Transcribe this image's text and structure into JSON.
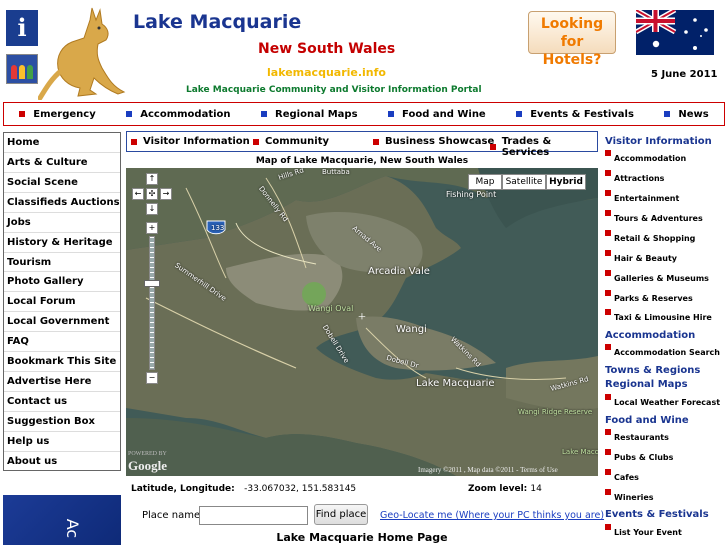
{
  "header": {
    "site_title": "Lake Macquarie",
    "state": "New South Wales",
    "domain": "lakemacquarie.info",
    "portal": "Lake Macquarie Community and Visitor Information Portal",
    "hotels_line1": "Looking for",
    "hotels_line2": "Hotels?",
    "date": "5 June 2011",
    "info_glyph": "i"
  },
  "top_nav": [
    {
      "label": "Emergency",
      "color": "#cc0000"
    },
    {
      "label": "Accommodation",
      "color": "#1a3dc0"
    },
    {
      "label": "Regional Maps",
      "color": "#1a3dc0"
    },
    {
      "label": "Food and Wine",
      "color": "#1a3dc0"
    },
    {
      "label": "Events & Festivals",
      "color": "#1a3dc0"
    },
    {
      "label": "News",
      "color": "#1a3dc0"
    }
  ],
  "left_nav": [
    "Home",
    "Arts & Culture",
    "Social Scene",
    "Classifieds Auctions",
    "Jobs",
    "History & Heritage",
    "Tourism",
    "Photo Gallery",
    "Local Forum",
    "Local Government",
    "FAQ",
    "Bookmark This Site",
    "Advertise Here",
    "Contact us",
    "Suggestion Box",
    "Help us",
    "About us"
  ],
  "left_ad_text": "Ac",
  "sub_nav": [
    "Visitor Information",
    "Community",
    "Business Showcase",
    "Trades & Services"
  ],
  "map": {
    "title": "Map of Lake Macquarie, New South Wales",
    "type_buttons": [
      "Map",
      "Satellite",
      "Hybrid"
    ],
    "active_type": "Hybrid",
    "places": [
      "Arcadia Vale",
      "Wangi",
      "Wangi Oval",
      "Fishing Point",
      "Lake Macquarie",
      "Wangi Ridge Reserve",
      "Lake Macquarie State..."
    ],
    "place_wangi2": "Wangi",
    "place_lm_state": "Lake Macquarie State",
    "roads": [
      "Hills Rd",
      "Buttaba",
      "Donnelly Rd",
      "Arnad Ave",
      "Summerhill Drive",
      "Dobell Drive",
      "Watkins Rd",
      "Dobell Dr",
      "Watkins Rd",
      "Dobell Drive"
    ],
    "road_133": "133",
    "attribution": "Imagery ©2011 , Map data ©2011 - Terms of Use",
    "logo": "Google",
    "powered_by": "POWERED BY"
  },
  "location": {
    "latlng_label": "Latitude, Longitude:",
    "latlng_value": "-33.067032, 151.583145",
    "zoom_label": "Zoom level:",
    "zoom_value": "14"
  },
  "search": {
    "place_label": "Place name:",
    "place_value": "",
    "find_label": "Find place",
    "geo_link": "Geo-Locate me (Where your PC thinks you are)"
  },
  "home_title": "Lake Macquarie Home Page",
  "right_sections": [
    {
      "heading": "Visitor Information",
      "items": [
        "Accommodation",
        "Attractions",
        "Entertainment",
        "Tours & Adventures",
        "Retail & Shopping",
        "Hair & Beauty",
        "Galleries & Museums",
        "Parks & Reserves",
        "Taxi & Limousine Hire"
      ]
    },
    {
      "heading": "Accommodation",
      "items": [
        "Accommodation Search"
      ]
    },
    {
      "heading": "Towns & Regions",
      "items": []
    },
    {
      "heading": "Regional Maps",
      "items": [
        "Local Weather Forecast"
      ]
    },
    {
      "heading": "Food and Wine",
      "items": [
        "Restaurants",
        "Pubs & Clubs",
        "Cafes",
        "Wineries"
      ]
    },
    {
      "heading": "Events & Festivals",
      "items": [
        "List Your Event"
      ]
    }
  ]
}
